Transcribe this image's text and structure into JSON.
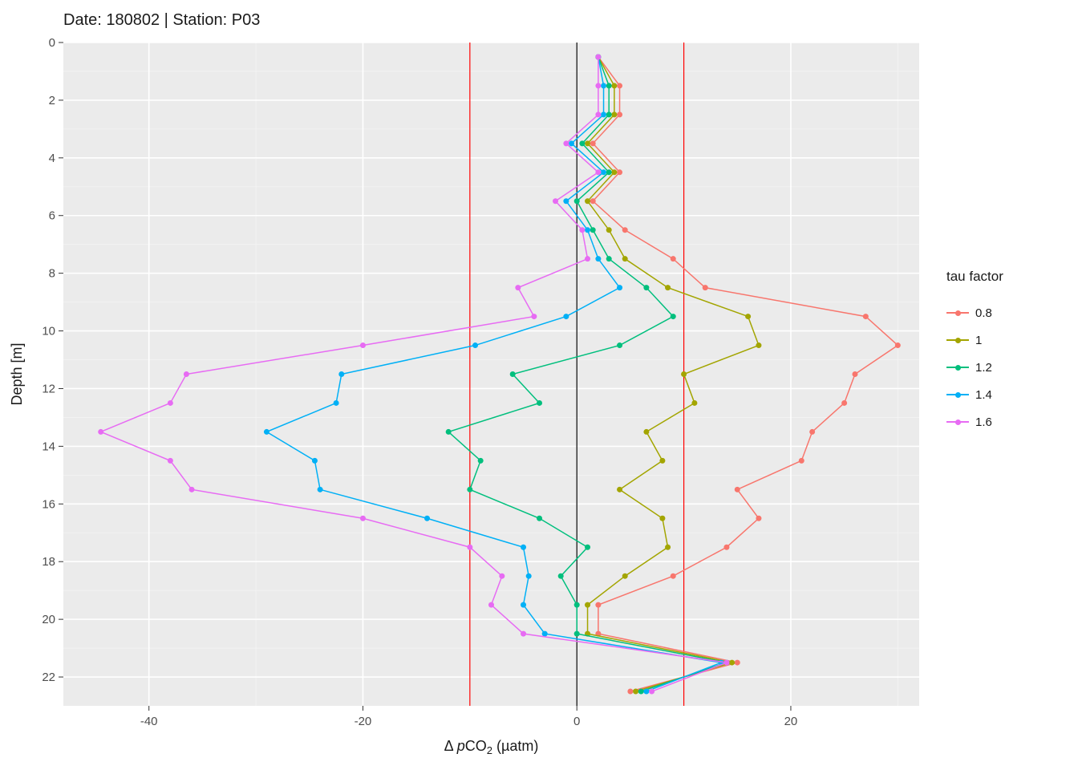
{
  "chart_data": {
    "type": "line",
    "title": "Date: 180802 | Station: P03",
    "xlabel": "Δ pCO₂ (µatm)",
    "ylabel": "Depth [m]",
    "xlim": [
      -48,
      32
    ],
    "ylim": [
      23,
      0
    ],
    "x_ticks": [
      -40,
      -20,
      0,
      20
    ],
    "y_ticks": [
      0,
      2,
      4,
      6,
      8,
      10,
      12,
      14,
      16,
      18,
      20,
      22
    ],
    "vlines": [
      {
        "x": -10,
        "color": "#ff0000"
      },
      {
        "x": 0,
        "color": "#000000"
      },
      {
        "x": 10,
        "color": "#ff0000"
      }
    ],
    "legend_title": "tau factor",
    "legend_position": "right",
    "grid": true,
    "depths": [
      0.5,
      1.5,
      2.5,
      3.5,
      4.5,
      5.5,
      6.5,
      7.5,
      8.5,
      9.5,
      10.5,
      11.5,
      12.5,
      13.5,
      14.5,
      15.5,
      16.5,
      17.5,
      18.5,
      19.5,
      20.5,
      21.5,
      22.5
    ],
    "series": [
      {
        "name": "0.8",
        "color": "#F8766D",
        "values": [
          2.0,
          4.0,
          4.0,
          1.5,
          4.0,
          1.5,
          4.5,
          9.0,
          12.0,
          27.0,
          30.0,
          26.0,
          25.0,
          22.0,
          21.0,
          15.0,
          17.0,
          14.0,
          9.0,
          2.0,
          2.0,
          15.0,
          5.0
        ]
      },
      {
        "name": "1",
        "color": "#A3A500",
        "values": [
          2.0,
          3.5,
          3.5,
          1.0,
          3.5,
          1.0,
          3.0,
          4.5,
          8.5,
          16.0,
          17.0,
          10.0,
          11.0,
          6.5,
          8.0,
          4.0,
          8.0,
          8.5,
          4.5,
          1.0,
          1.0,
          14.5,
          5.5
        ]
      },
      {
        "name": "1.2",
        "color": "#00BF7D",
        "values": [
          2.0,
          3.0,
          3.0,
          0.5,
          3.0,
          0.0,
          1.5,
          3.0,
          6.5,
          9.0,
          4.0,
          -6.0,
          -3.5,
          -12.0,
          -9.0,
          -10.0,
          -3.5,
          1.0,
          -1.5,
          0.0,
          0.0,
          14.0,
          6.0
        ]
      },
      {
        "name": "1.4",
        "color": "#00B0F6",
        "values": [
          2.0,
          2.5,
          2.5,
          -0.5,
          2.5,
          -1.0,
          1.0,
          2.0,
          4.0,
          -1.0,
          -9.5,
          -22.0,
          -22.5,
          -29.0,
          -24.5,
          -24.0,
          -14.0,
          -5.0,
          -4.5,
          -5.0,
          -3.0,
          13.5,
          6.5
        ]
      },
      {
        "name": "1.6",
        "color": "#E76BF3",
        "values": [
          2.0,
          2.0,
          2.0,
          -1.0,
          2.0,
          -2.0,
          0.5,
          1.0,
          -5.5,
          -4.0,
          -20.0,
          -36.5,
          -38.0,
          -44.5,
          -38.0,
          -36.0,
          -20.0,
          -10.0,
          -7.0,
          -8.0,
          -5.0,
          14.0,
          7.0
        ]
      }
    ]
  }
}
